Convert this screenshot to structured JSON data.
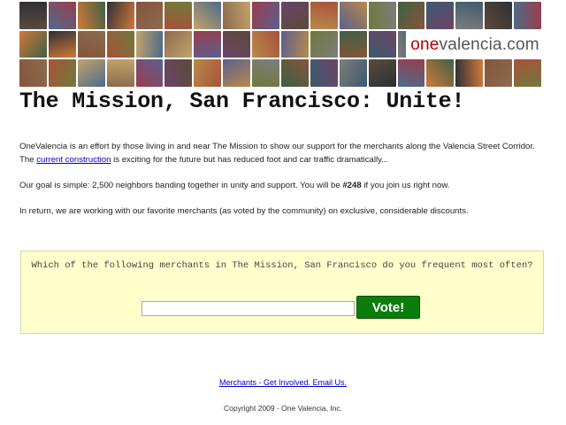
{
  "logo": {
    "brand": "one",
    "rest": "valencia.com"
  },
  "page_title": "The Mission, San Francisco: Unite!",
  "intro": {
    "text_before": "OneValencia is an effort by those living in and near The Mission to show our support for the merchants along the Valencia Street Corridor. The ",
    "link_text": "current construction",
    "text_after": " is exciting for the future but has reduced foot and car traffic dramatically..."
  },
  "goal": {
    "text_before": "Our goal is simple: 2,500 neighbors banding together in unity and support. You will be ",
    "number": "#248",
    "text_after": " if you join us right now."
  },
  "return_text": "In return, we are working with our favorite merchants (as voted by the community) on exclusive, considerable discounts.",
  "vote": {
    "question": "Which of the following merchants in The Mission, San Francisco do you frequent most often?",
    "input_value": "",
    "button_label": "Vote!"
  },
  "footer": {
    "link_text": "Merchants - Get Involved. Email Us.",
    "copyright": "Copyright 2009 - One Valencia, Inc."
  },
  "colors": {
    "vote_box_bg": "#ffffcc",
    "vote_button": "#0a7d0a",
    "link": "#0000cc",
    "logo_brand": "#b00000"
  }
}
